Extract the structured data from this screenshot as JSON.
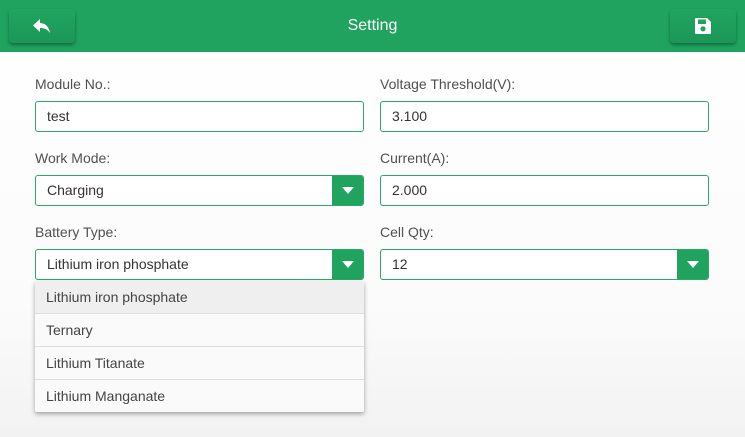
{
  "header": {
    "title": "Setting",
    "back_icon": "back-arrow-icon",
    "save_icon": "save-icon",
    "color": "#1fa35f"
  },
  "form": {
    "module_no": {
      "label": "Module No.:",
      "value": "test"
    },
    "voltage_threshold": {
      "label": "Voltage Threshold(V):",
      "value": "3.100"
    },
    "work_mode": {
      "label": "Work Mode:",
      "value": "Charging"
    },
    "current": {
      "label": "Current(A):",
      "value": "2.000"
    },
    "battery_type": {
      "label": "Battery Type:",
      "value": "Lithium iron phosphate"
    },
    "cell_qty": {
      "label": "Cell Qty:",
      "value": "12"
    }
  },
  "battery_type_dropdown": {
    "options": [
      "Lithium iron phosphate",
      "Ternary",
      "Lithium Titanate",
      "Lithium Manganate"
    ]
  }
}
